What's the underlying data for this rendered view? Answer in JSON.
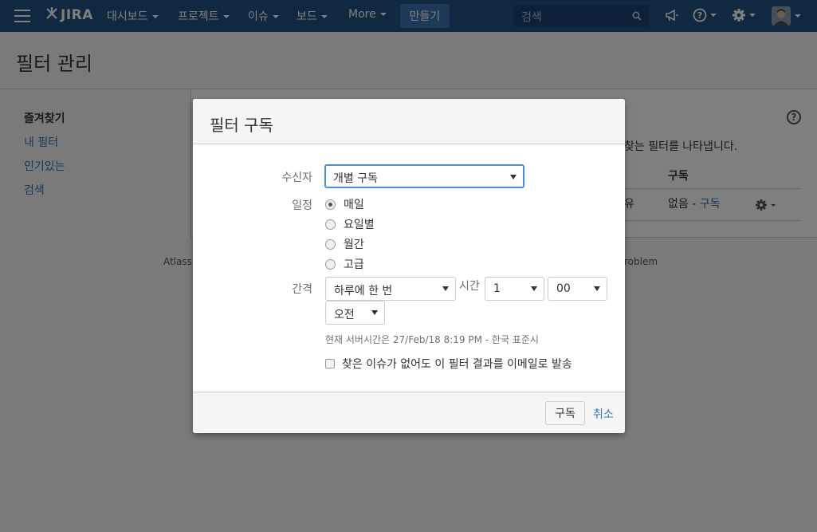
{
  "topnav": {
    "logo_text": "JIRA",
    "items": [
      {
        "label": "대시보드"
      },
      {
        "label": "프로젝트"
      },
      {
        "label": "이슈"
      },
      {
        "label": "보드"
      },
      {
        "label": "More"
      }
    ],
    "create_label": "만들기",
    "search_placeholder": "검색"
  },
  "page": {
    "title": "필터 관리",
    "sidebar": {
      "heading": "즐겨찾기",
      "items": [
        {
          "label": "내 필터"
        },
        {
          "label": "인기있는"
        },
        {
          "label": "검색"
        }
      ]
    },
    "content": {
      "description": "찾는 필터를 나타냅니다.",
      "column_header": "구독",
      "row": {
        "edge_text": "유",
        "value": "없음",
        "separator": " - ",
        "link": "구독"
      }
    },
    "footer": {
      "left": "Atlassi",
      "right": "roblem"
    }
  },
  "dialog": {
    "title": "필터 구독",
    "recipient": {
      "label": "수신자",
      "value": "개별 구독"
    },
    "schedule": {
      "label": "일정",
      "options": [
        {
          "label": "매일",
          "selected": true
        },
        {
          "label": "요일별",
          "selected": false
        },
        {
          "label": "월간",
          "selected": false
        },
        {
          "label": "고급",
          "selected": false
        }
      ]
    },
    "interval": {
      "label": "간격",
      "value": "하루에 한 번"
    },
    "time": {
      "label": "시간",
      "hour": "1",
      "minute": "00",
      "ampm": "오전"
    },
    "server_time_note": "현재 서버시간은 27/Feb/18 8:19 PM - 한국 표준시",
    "email_checkbox": {
      "label": "찾은 이슈가 없어도 이 필터 결과를 이메일로 발송",
      "checked": false
    },
    "subscribe_button": "구독",
    "cancel_link": "취소"
  },
  "colors": {
    "nav_bg": "#205081",
    "create_bg": "#3b73af",
    "link": "#3b73af",
    "focus_border": "#4a90d9"
  }
}
